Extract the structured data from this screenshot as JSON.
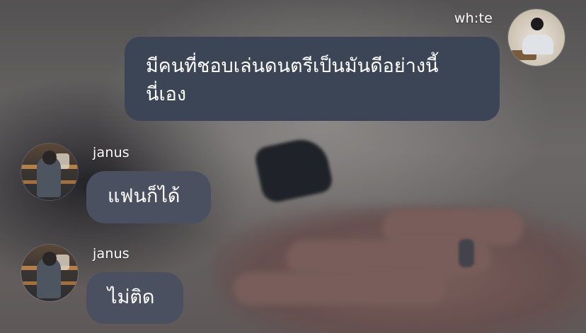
{
  "messages": [
    {
      "sender": "wh:te",
      "side": "right",
      "lines": [
        "มีคนที่ชอบเล่นดนตรีเป็นมันดีอย่างนี้",
        "นี่เอง"
      ]
    },
    {
      "sender": "janus",
      "side": "left",
      "text": "แฟนก็ได้"
    },
    {
      "sender": "janus",
      "side": "left",
      "text": "ไม่ติด"
    }
  ],
  "colors": {
    "my_bubble": "#3b4556",
    "their_bubble": "#4a5060",
    "text": "#ffffff"
  }
}
